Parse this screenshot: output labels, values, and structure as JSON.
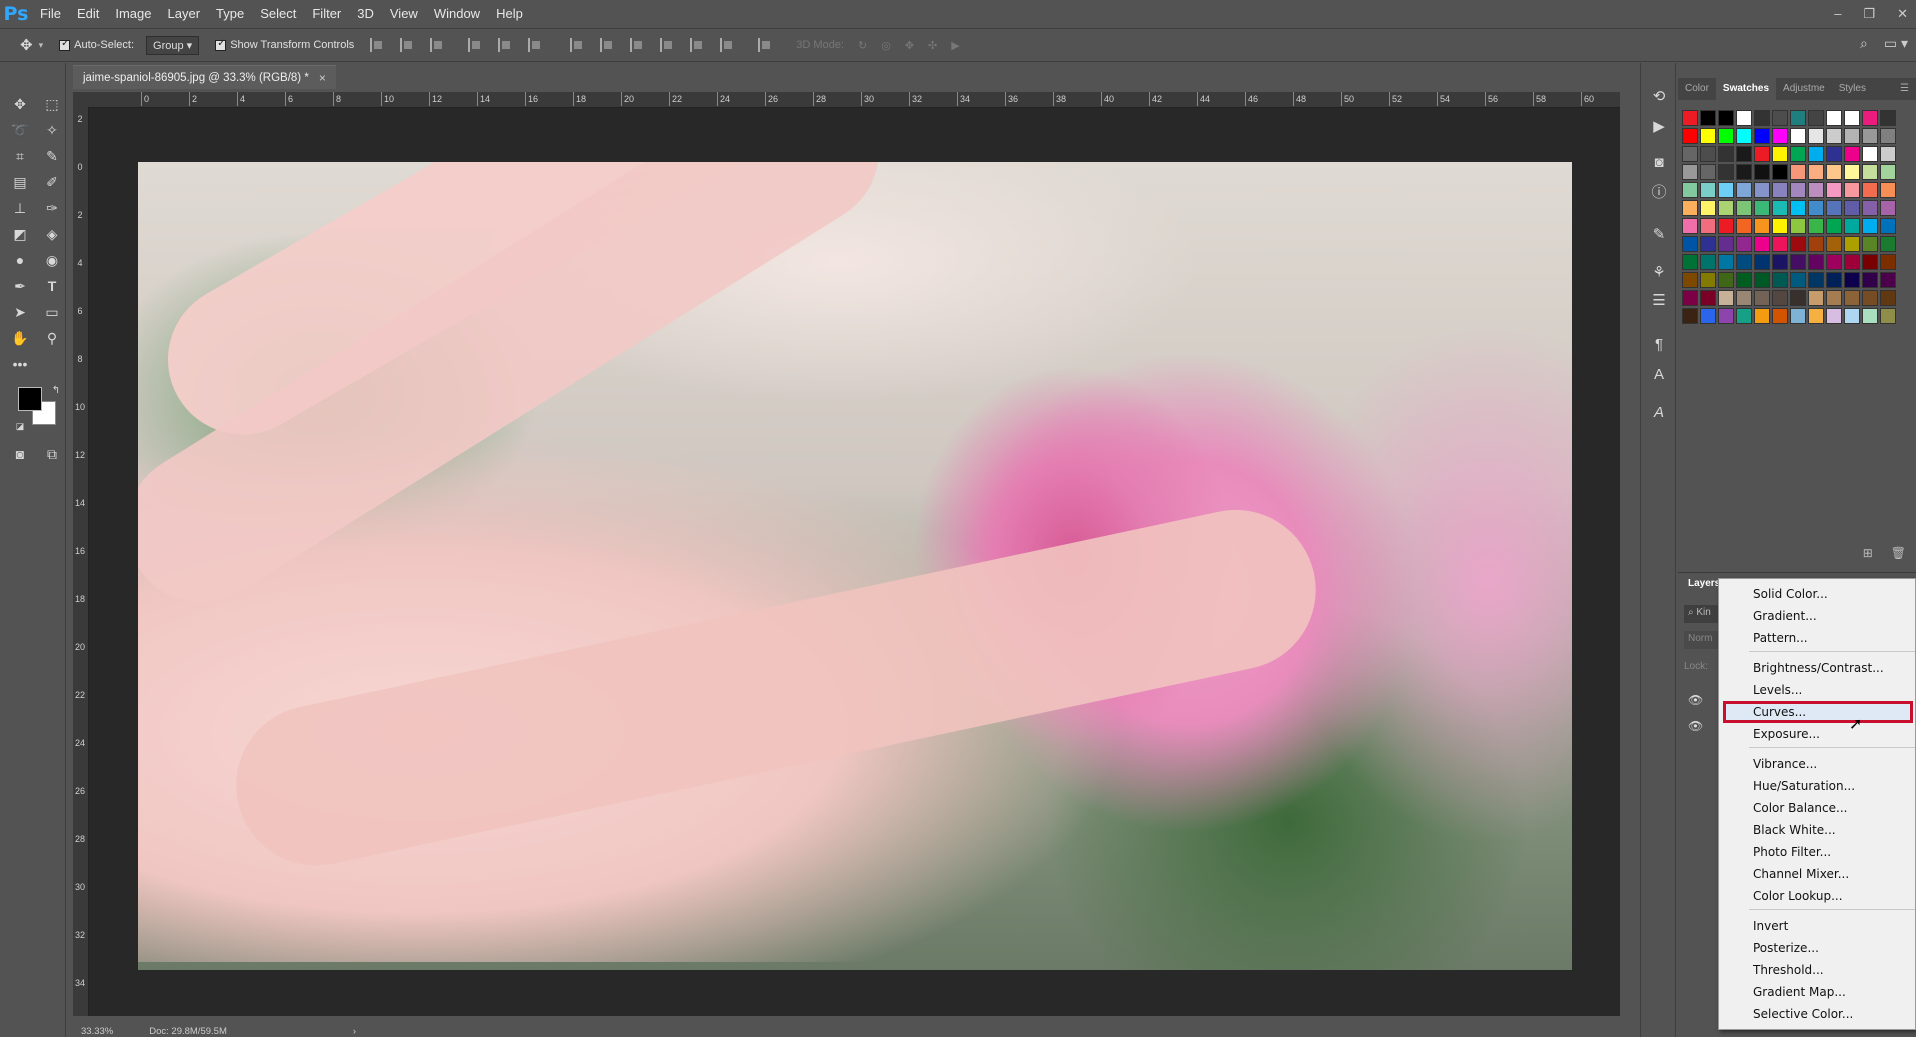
{
  "app": {
    "logo": "Ps"
  },
  "menu": [
    "File",
    "Edit",
    "Image",
    "Layer",
    "Type",
    "Select",
    "Filter",
    "3D",
    "View",
    "Window",
    "Help"
  ],
  "window_controls": [
    "–",
    "❐",
    "✕"
  ],
  "options": {
    "auto_select_label": "Auto-Select:",
    "auto_select_value": "Group",
    "show_transform_label": "Show Transform Controls",
    "mode_3d_label": "3D Mode:"
  },
  "document": {
    "tab_title": "jaime-spaniol-86905.jpg @ 33.3% (RGB/8) *",
    "close_glyph": "×"
  },
  "rulers": {
    "top": [
      "0",
      "2",
      "4",
      "6",
      "8",
      "10",
      "12",
      "14",
      "16",
      "18",
      "20",
      "22",
      "24",
      "26",
      "28",
      "30",
      "32",
      "34",
      "36",
      "38",
      "40",
      "42",
      "44",
      "46",
      "48",
      "50",
      "52",
      "54",
      "56",
      "58",
      "60"
    ],
    "left": [
      "2",
      "0",
      "2",
      "4",
      "6",
      "8",
      "10",
      "12",
      "14",
      "16",
      "18",
      "20",
      "22",
      "24",
      "26",
      "28",
      "30",
      "32",
      "34"
    ]
  },
  "status": {
    "zoom": "33.33%",
    "doc": "Doc: 29.8M/59.5M",
    "arrow": "›"
  },
  "panels": {
    "tabs": [
      "Color",
      "Swatches",
      "Adjustme",
      "Styles"
    ],
    "active_tab": "Swatches",
    "layers_tab": "Layers",
    "layers_kind": "Kin",
    "layers_normal": "Norm",
    "layers_lock": "Lock:"
  },
  "swatches": [
    "#ed1c24",
    "#000000",
    "#000000",
    "#ffffff",
    "#333333",
    "#4d4d4d",
    "#1f7f7f",
    "#444444",
    "#ffffff",
    "#ffffff",
    "#ec1c7f",
    "#333333",
    "#ff0000",
    "#ffff00",
    "#00ff00",
    "#00ffff",
    "#0000ff",
    "#ff00ff",
    "#ffffff",
    "#e6e6e6",
    "#cccccc",
    "#b3b3b3",
    "#999999",
    "#808080",
    "#666666",
    "#4d4d4d",
    "#333333",
    "#1a1a1a",
    "#ed1c24",
    "#fff200",
    "#00a651",
    "#00aeef",
    "#2e3192",
    "#ec008c",
    "#ffffff",
    "#cccccc",
    "#999999",
    "#666666",
    "#333333",
    "#1a1a1a",
    "#111111",
    "#000000",
    "#f7977a",
    "#f9ad81",
    "#fdc68a",
    "#fff79a",
    "#c4df9b",
    "#a2d39c",
    "#82ca9d",
    "#7bcdc8",
    "#6ecff6",
    "#7ea7d8",
    "#8493ca",
    "#8882be",
    "#a187be",
    "#bc8dbf",
    "#f49ac2",
    "#f6989d",
    "#f26c4f",
    "#f68e56",
    "#fbaf5d",
    "#fff467",
    "#acd373",
    "#7cc576",
    "#3bb878",
    "#1abbb4",
    "#00bff3",
    "#438ccb",
    "#5574b9",
    "#605ca8",
    "#855fa8",
    "#a763a8",
    "#f06eaa",
    "#f26d7d",
    "#ed1c24",
    "#f26522",
    "#f7941d",
    "#fff200",
    "#8dc73f",
    "#39b54a",
    "#00a651",
    "#00a99d",
    "#00aeef",
    "#0072bc",
    "#0054a6",
    "#2e3192",
    "#662d91",
    "#92278f",
    "#ec008c",
    "#ed145b",
    "#9e0b0f",
    "#a0410d",
    "#a36209",
    "#aba000",
    "#598527",
    "#1a7b30",
    "#007236",
    "#00746b",
    "#0076a3",
    "#004b80",
    "#003471",
    "#1b1464",
    "#440e62",
    "#630460",
    "#9e005d",
    "#9e0039",
    "#790000",
    "#7b2e00",
    "#7d4900",
    "#827b00",
    "#406618",
    "#005e20",
    "#005826",
    "#005952",
    "#005b7f",
    "#003663",
    "#002157",
    "#0d004c",
    "#32004b",
    "#4b0049",
    "#7b0046",
    "#7a0026",
    "#c7b299",
    "#998675",
    "#736357",
    "#534741",
    "#37302d",
    "#c69c6d",
    "#a67c52",
    "#8c6239",
    "#754c24",
    "#603913",
    "#3b2314",
    "#2b65ec",
    "#8e44ad",
    "#16a085",
    "#f39c12",
    "#d35400",
    "#7fb3d5",
    "#f5b041",
    "#d7bde2",
    "#aed6f1",
    "#a9dfbf",
    "#8e8e4a"
  ],
  "context_menu": [
    "Solid Color...",
    "Gradient...",
    "Pattern...",
    "Brightness/Contrast...",
    "Levels...",
    "Curves...",
    "Exposure...",
    "Vibrance...",
    "Hue/Saturation...",
    "Color Balance...",
    "Black  White...",
    "Photo Filter...",
    "Channel Mixer...",
    "Color Lookup...",
    "Invert",
    "Posterize...",
    "Threshold...",
    "Gradient Map...",
    "Selective Color..."
  ],
  "highlighted_item": "Curves...",
  "highlight_color": "#c8102e",
  "icons": {
    "tools": [
      "move-icon",
      "marquee-icon",
      "lasso-icon",
      "magic-wand-icon",
      "crop-icon",
      "eyedropper-icon",
      "healing-icon",
      "brush-icon",
      "stamp-icon",
      "history-brush-icon",
      "eraser-icon",
      "paint-bucket-icon",
      "blur-icon",
      "dodge-icon",
      "pen-icon",
      "type-icon",
      "path-select-icon",
      "rectangle-icon",
      "hand-icon",
      "zoom-icon"
    ],
    "strip": [
      "history-icon",
      "play-icon",
      "camera-icon",
      "info-icon",
      "brush-preset-icon",
      "adjustments-icon",
      "properties-icon",
      "paragraph-icon",
      "character-icon",
      "glyph-icon"
    ]
  }
}
